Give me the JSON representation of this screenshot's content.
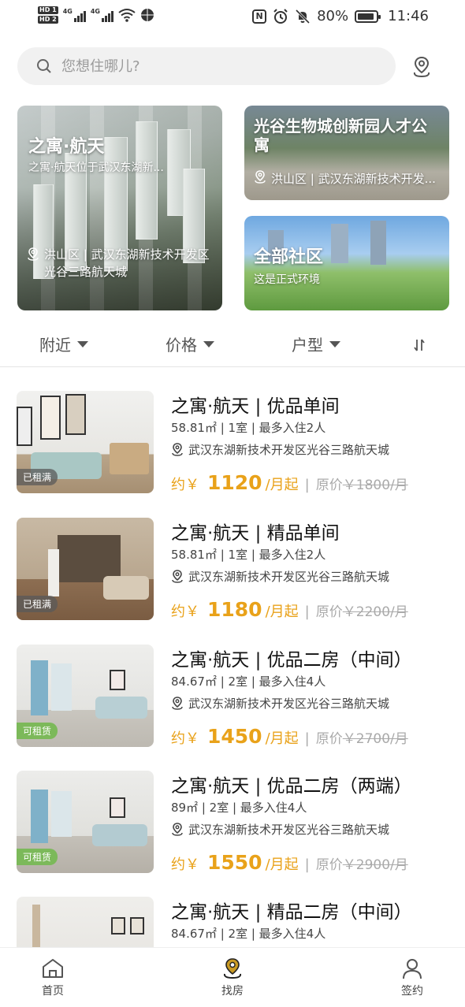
{
  "status_bar": {
    "hd1": "HD 1",
    "hd2": "HD 2",
    "net1": "4G",
    "net2": "4G",
    "battery": "80%",
    "time": "11:46",
    "nfc": "N"
  },
  "search": {
    "placeholder": "您想住哪儿?"
  },
  "banners": [
    {
      "title": "之寓·航天",
      "subtitle": "之寓·航天位于武汉东湖新...",
      "address": "洪山区 | 武汉东湖新技术开发区光谷三路航天城"
    },
    {
      "title": "光谷生物城创新园人才公寓",
      "address": "洪山区 | 武汉东湖新技术开发..."
    },
    {
      "title": "全部社区",
      "subtitle": "这是正式环境"
    }
  ],
  "filters": {
    "nearby": "附近",
    "price": "价格",
    "layout": "户型"
  },
  "listings": [
    {
      "title": "之寓·航天 | 优品单间",
      "meta": "58.81㎡ | 1室 | 最多入住2人",
      "address": "武汉东湖新技术开发区光谷三路航天城",
      "price_prefix": "约￥",
      "price": "1120",
      "unit": "/月起",
      "orig_label": "原价",
      "orig": "￥1800/月",
      "badge": "已租满",
      "status": "full"
    },
    {
      "title": "之寓·航天 | 精品单间",
      "meta": "58.81㎡ | 1室 | 最多入住2人",
      "address": "武汉东湖新技术开发区光谷三路航天城",
      "price_prefix": "约￥",
      "price": "1180",
      "unit": "/月起",
      "orig_label": "原价",
      "orig": "￥2200/月",
      "badge": "已租满",
      "status": "full"
    },
    {
      "title": "之寓·航天 | 优品二房（中间）",
      "meta": "84.67㎡ | 2室 | 最多入住4人",
      "address": "武汉东湖新技术开发区光谷三路航天城",
      "price_prefix": "约￥",
      "price": "1450",
      "unit": "/月起",
      "orig_label": "原价",
      "orig": "￥2700/月",
      "badge": "可租赁",
      "status": "avail"
    },
    {
      "title": "之寓·航天 | 优品二房（两端）",
      "meta": "89㎡ | 2室 | 最多入住4人",
      "address": "武汉东湖新技术开发区光谷三路航天城",
      "price_prefix": "约￥",
      "price": "1550",
      "unit": "/月起",
      "orig_label": "原价",
      "orig": "￥2900/月",
      "badge": "可租赁",
      "status": "avail"
    },
    {
      "title": "之寓·航天 | 精品二房（中间）",
      "meta": "84.67㎡ | 2室 | 最多入住4人"
    }
  ],
  "tabs": {
    "home": "首页",
    "find": "找房",
    "sign": "签约"
  },
  "colors": {
    "accent": "#e9a21a",
    "available": "#7cb95a",
    "tab_active": "#c99a23"
  }
}
